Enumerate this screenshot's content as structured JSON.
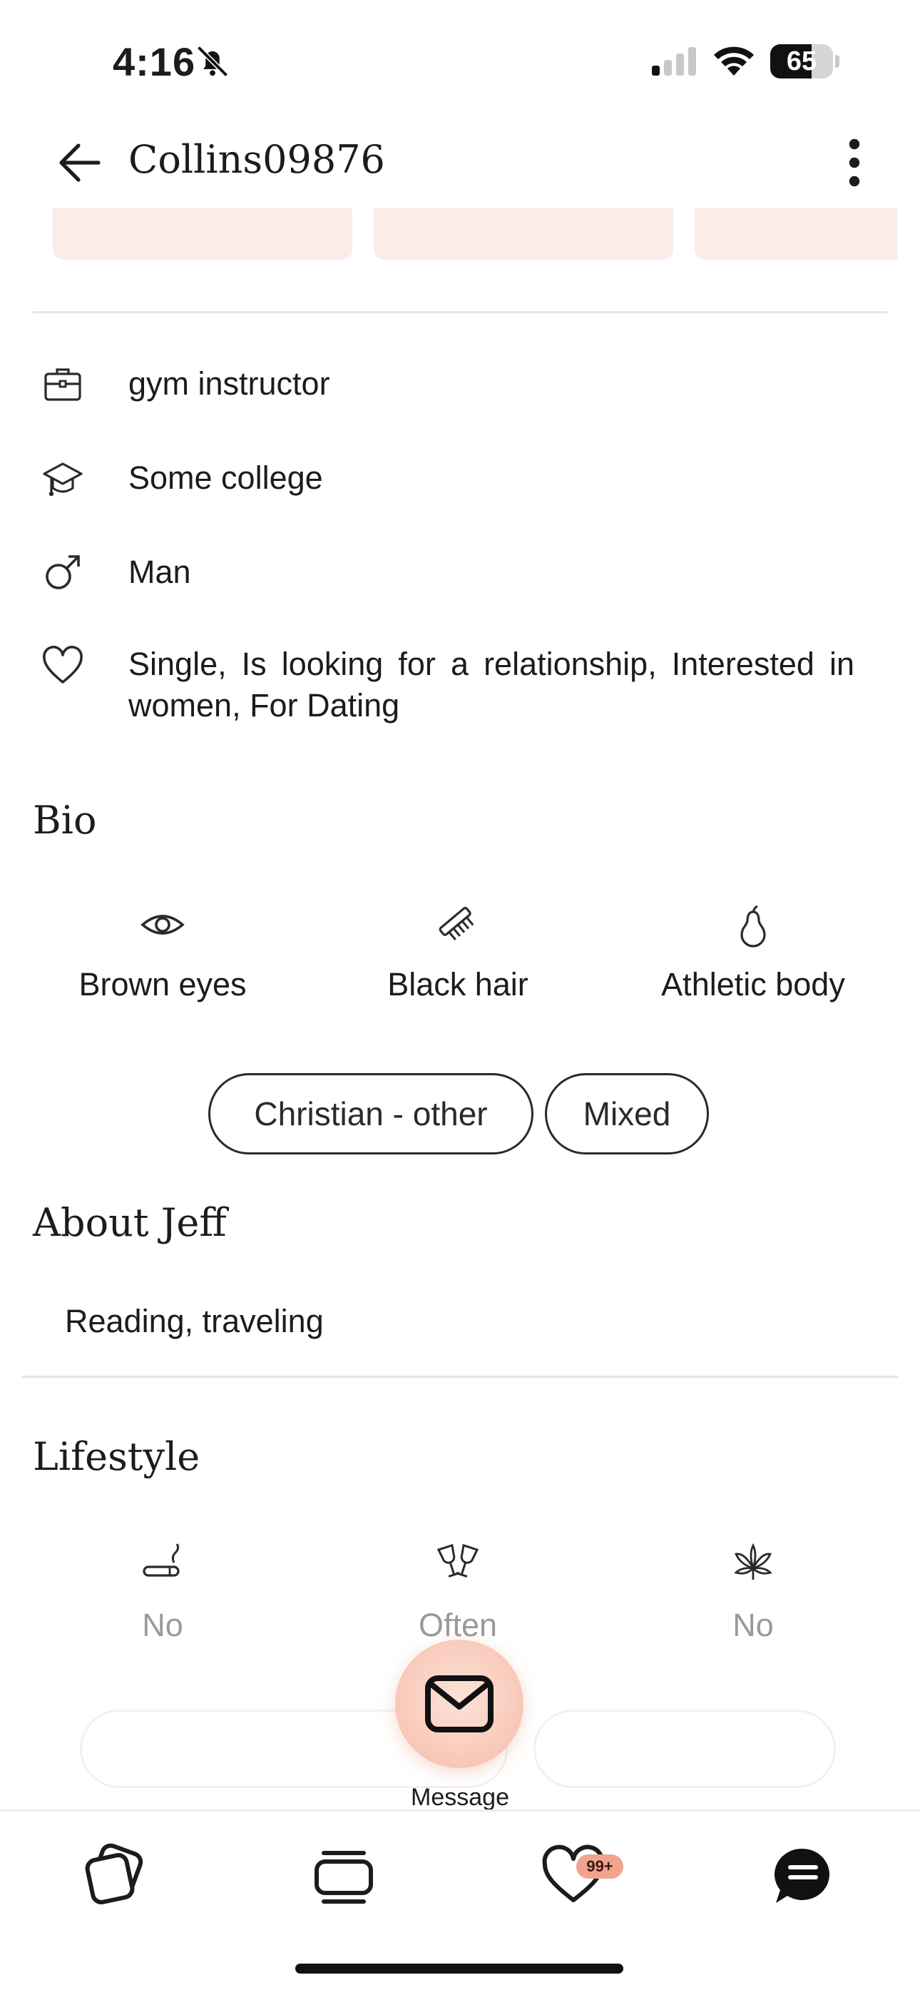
{
  "status_bar": {
    "time": "4:16",
    "battery": "65"
  },
  "header": {
    "title": "Collins09876"
  },
  "info": {
    "occupation": "gym instructor",
    "education": "Some college",
    "gender": "Man",
    "relationship": "Single, Is looking for a relationship, Interested in women, For Dating"
  },
  "bio": {
    "title": "Bio",
    "traits": [
      {
        "icon": "eye-icon",
        "label": "Brown eyes"
      },
      {
        "icon": "comb-icon",
        "label": "Black hair"
      },
      {
        "icon": "pear-icon",
        "label": "Athletic body"
      }
    ],
    "chips": [
      "Christian - other",
      "Mixed"
    ]
  },
  "about": {
    "title": "About Jeff",
    "text": "Reading, traveling"
  },
  "lifestyle": {
    "title": "Lifestyle",
    "items": [
      {
        "icon": "cigarette-icon",
        "label": "No"
      },
      {
        "icon": "wine-glasses-icon",
        "label": "Often"
      },
      {
        "icon": "cannabis-leaf-icon",
        "label": "No"
      }
    ]
  },
  "message_button": {
    "label": "Message"
  },
  "tabbar": {
    "likes_badge": "99+"
  }
}
